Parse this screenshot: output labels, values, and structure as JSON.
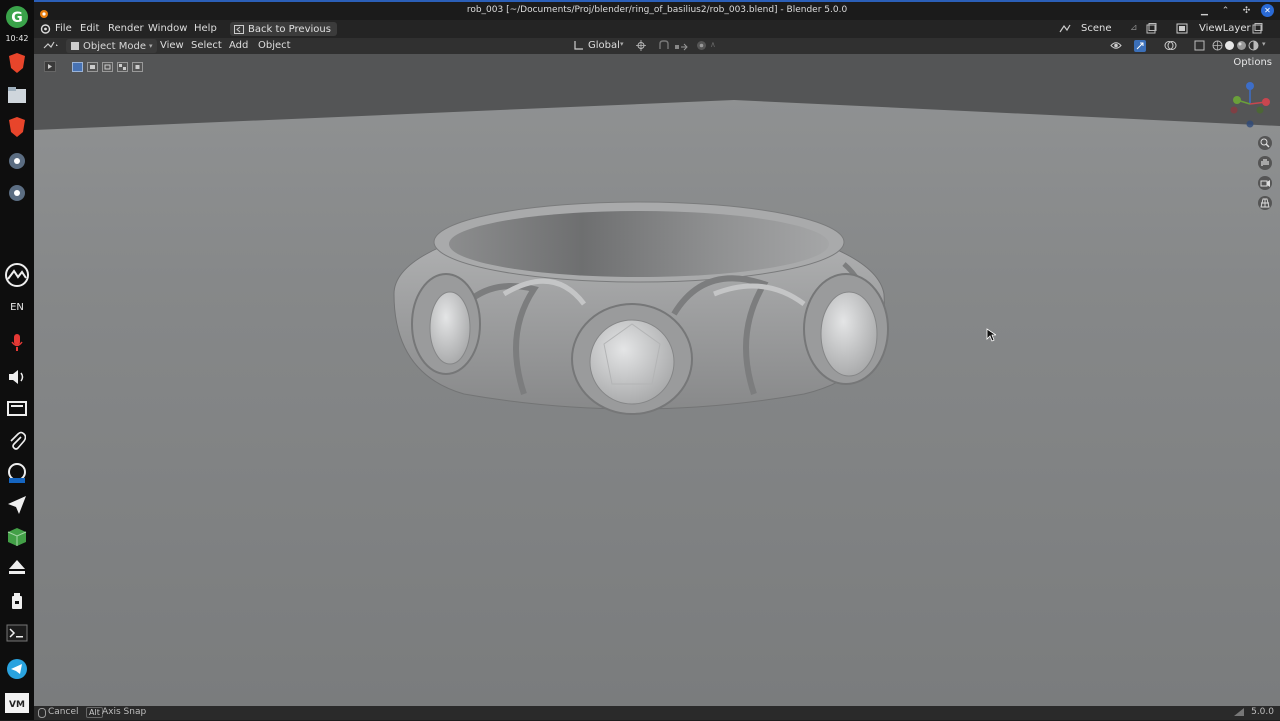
{
  "dock": {
    "clock": "10:42",
    "lang": "EN",
    "icons": [
      "g-app-icon",
      "brave-icon",
      "files-icon",
      "brave-icon",
      "settings-icon",
      "settings-icon",
      "activity-icon",
      "microphone-icon",
      "speaker-icon",
      "screen-icon",
      "paperclip-icon",
      "screen-recorder-icon",
      "send-icon",
      "box-icon",
      "eject-icon",
      "usb-icon",
      "terminal-icon",
      "telegram-icon",
      "vm-icon"
    ]
  },
  "window": {
    "title": "rob_003 [~/Documents/Proj/blender/ring_of_basilius2/rob_003.blend] - Blender 5.0.0"
  },
  "topbar": {
    "menus": [
      "File",
      "Edit",
      "Render",
      "Window",
      "Help"
    ],
    "back_label": "Back to Previous",
    "scene": "Scene",
    "view_layer": "ViewLayer"
  },
  "header": {
    "mode": "Object Mode",
    "menus": [
      "View",
      "Select",
      "Add",
      "Object"
    ],
    "orientation": "Global"
  },
  "viewport": {
    "options_label": "Options",
    "gizmo_axes": [
      "X",
      "Y",
      "Z"
    ]
  },
  "statusbar": {
    "cancel_label": "Cancel",
    "alt_key": "Alt",
    "axis_snap_label": "Axis Snap",
    "version": "5.0.0"
  },
  "colors": {
    "accent": "#2a6ad6",
    "viewport_bg": "#7b7d7e",
    "back_wall": "#555657"
  }
}
